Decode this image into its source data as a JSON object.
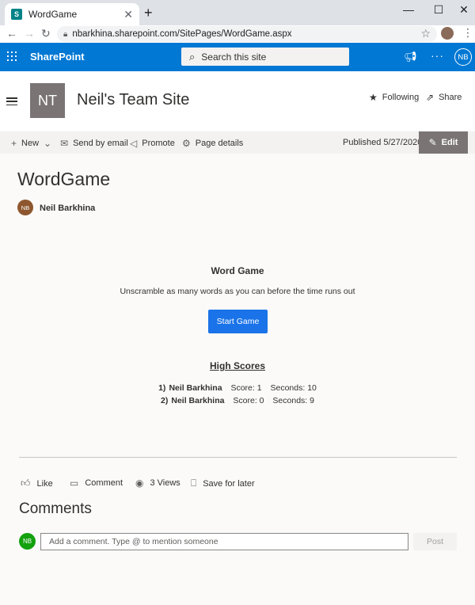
{
  "browser": {
    "tab_title": "WordGame",
    "favicon_letter": "S",
    "url": "nbarkhina.sharepoint.com/SitePages/WordGame.aspx",
    "icons": [
      "close-icon",
      "plus-icon",
      "minimize-icon",
      "maximize-icon",
      "window-close-icon",
      "back-icon",
      "forward-icon",
      "reload-icon",
      "lock-icon",
      "star-icon",
      "kebab-icon"
    ]
  },
  "suitebar": {
    "brand": "SharePoint",
    "search_placeholder": "Search this site",
    "user_initials": "NB",
    "color": "#0078d4"
  },
  "site": {
    "logo_initials": "NT",
    "title": "Neil's Team Site",
    "following_label": "Following",
    "share_label": "Share"
  },
  "commandbar": {
    "new_label": "New",
    "send_email_label": "Send by email",
    "promote_label": "Promote",
    "page_details_label": "Page details",
    "published": "Published 5/27/2020",
    "edit_label": "Edit"
  },
  "page": {
    "title": "WordGame",
    "author_initials": "NB",
    "author_name": "Neil Barkhina"
  },
  "game": {
    "heading": "Word Game",
    "description": "Unscramble as many words as you can before the time runs out",
    "start_button": "Start Game",
    "button_color": "#1a73e8",
    "high_scores_heading": "High Scores",
    "scores": [
      {
        "rank": "1)",
        "name": "Neil Barkhina",
        "score": "Score: 1",
        "seconds": "Seconds: 10"
      },
      {
        "rank": "2)",
        "name": "Neil Barkhina",
        "score": "Score: 0",
        "seconds": "Seconds: 9"
      }
    ]
  },
  "social": {
    "like_label": "Like",
    "comment_label": "Comment",
    "views_label": "3 Views",
    "save_label": "Save for later"
  },
  "comments": {
    "title": "Comments",
    "user_initials": "NB",
    "input_placeholder": "Add a comment. Type @ to mention someone",
    "post_label": "Post"
  }
}
